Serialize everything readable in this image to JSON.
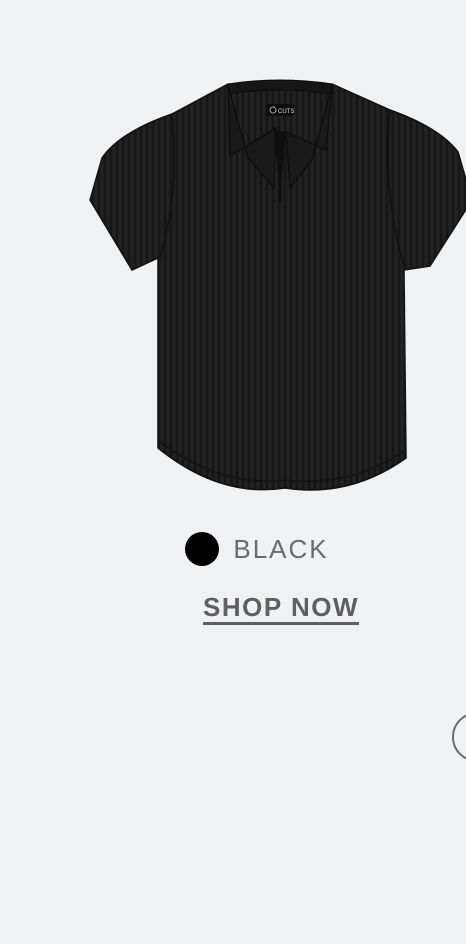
{
  "product": {
    "image_icon": "black-polo-shirt-image",
    "brand_mark": "CUTS",
    "color_name": "BLACK",
    "color_hex": "#000000",
    "cta_label": "SHOP NOW"
  },
  "carousel": {
    "next_icon": "carousel-next-button"
  },
  "colors": {
    "background": "#f0f1f3",
    "label_text": "#6b6b6b",
    "cta_text": "#5f5f5f"
  }
}
